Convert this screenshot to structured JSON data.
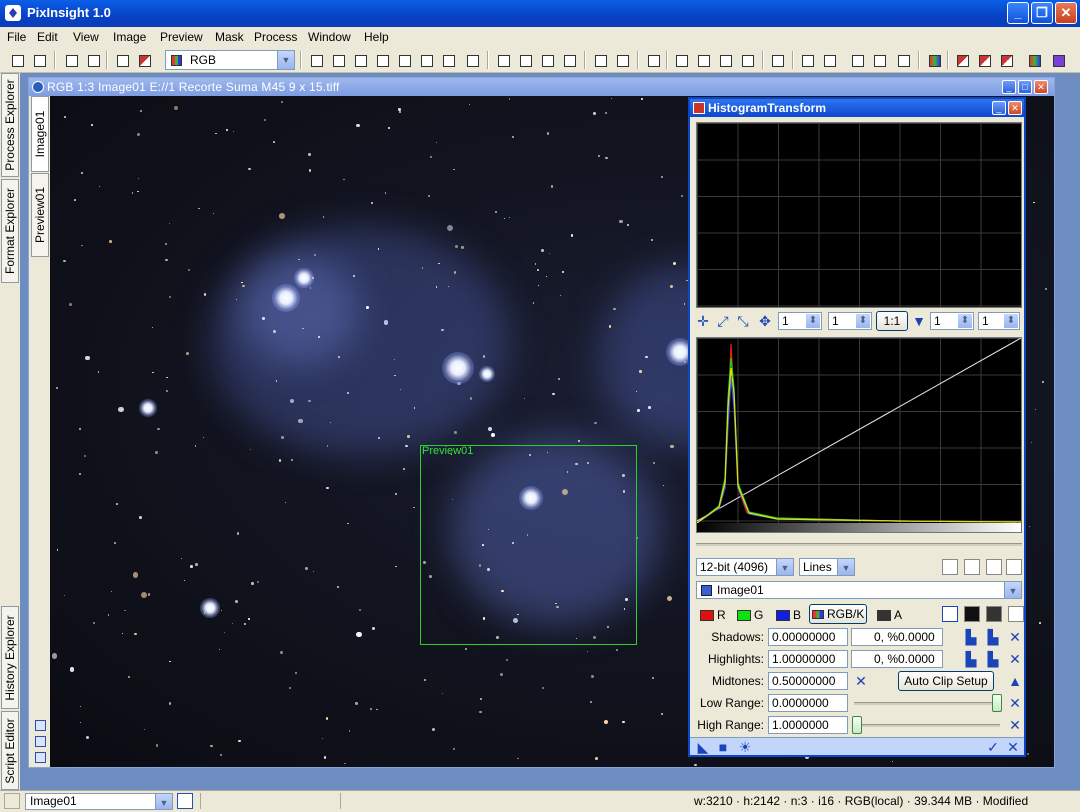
{
  "app": {
    "title": "PixInsight 1.0"
  },
  "menu": [
    "File",
    "Edit",
    "View",
    "Image",
    "Preview",
    "Mask",
    "Process",
    "Window",
    "Help"
  ],
  "toolbar": {
    "color_mode": "RGB"
  },
  "explorers": {
    "top": [
      "Process Explorer",
      "Format Explorer"
    ],
    "bottom": [
      "History Explorer",
      "Script Editor"
    ]
  },
  "image_window": {
    "title": "RGB 1:3 Image01 E://1 Recorte Suma M45 9 x 15.tiff",
    "tabs": [
      "Image01",
      "Preview01"
    ],
    "preview_label": "Preview01"
  },
  "histogram": {
    "title": "HistogramTransform",
    "zoom": {
      "x1": "1",
      "y1": "1",
      "ratio": "1:1",
      "x2": "1",
      "y2": "1"
    },
    "resolution": "12-bit (4096)",
    "graph_style": "Lines",
    "view": "Image01",
    "channels": {
      "r": "R",
      "g": "G",
      "b": "B",
      "rgbk": "RGB/K",
      "a": "A"
    },
    "labels": {
      "shadows": "Shadows:",
      "highlights": "Highlights:",
      "midtones": "Midtones:",
      "low_range": "Low Range:",
      "high_range": "High Range:"
    },
    "values": {
      "shadows": "0.00000000",
      "shadows_clip": "0, %0.0000",
      "highlights": "1.00000000",
      "highlights_clip": "0, %0.0000",
      "midtones": "0.50000000",
      "low_range": "0.0000000",
      "high_range": "1.0000000"
    },
    "auto_clip": "Auto Clip Setup"
  },
  "status": {
    "view": "Image01",
    "info": "w:3210 · h:2142 · n:3 · i16 · RGB(local) · 39.344 MB · Modified"
  },
  "colors": {
    "title_blue": "#0842c4",
    "preview_green": "#2bd02b"
  }
}
